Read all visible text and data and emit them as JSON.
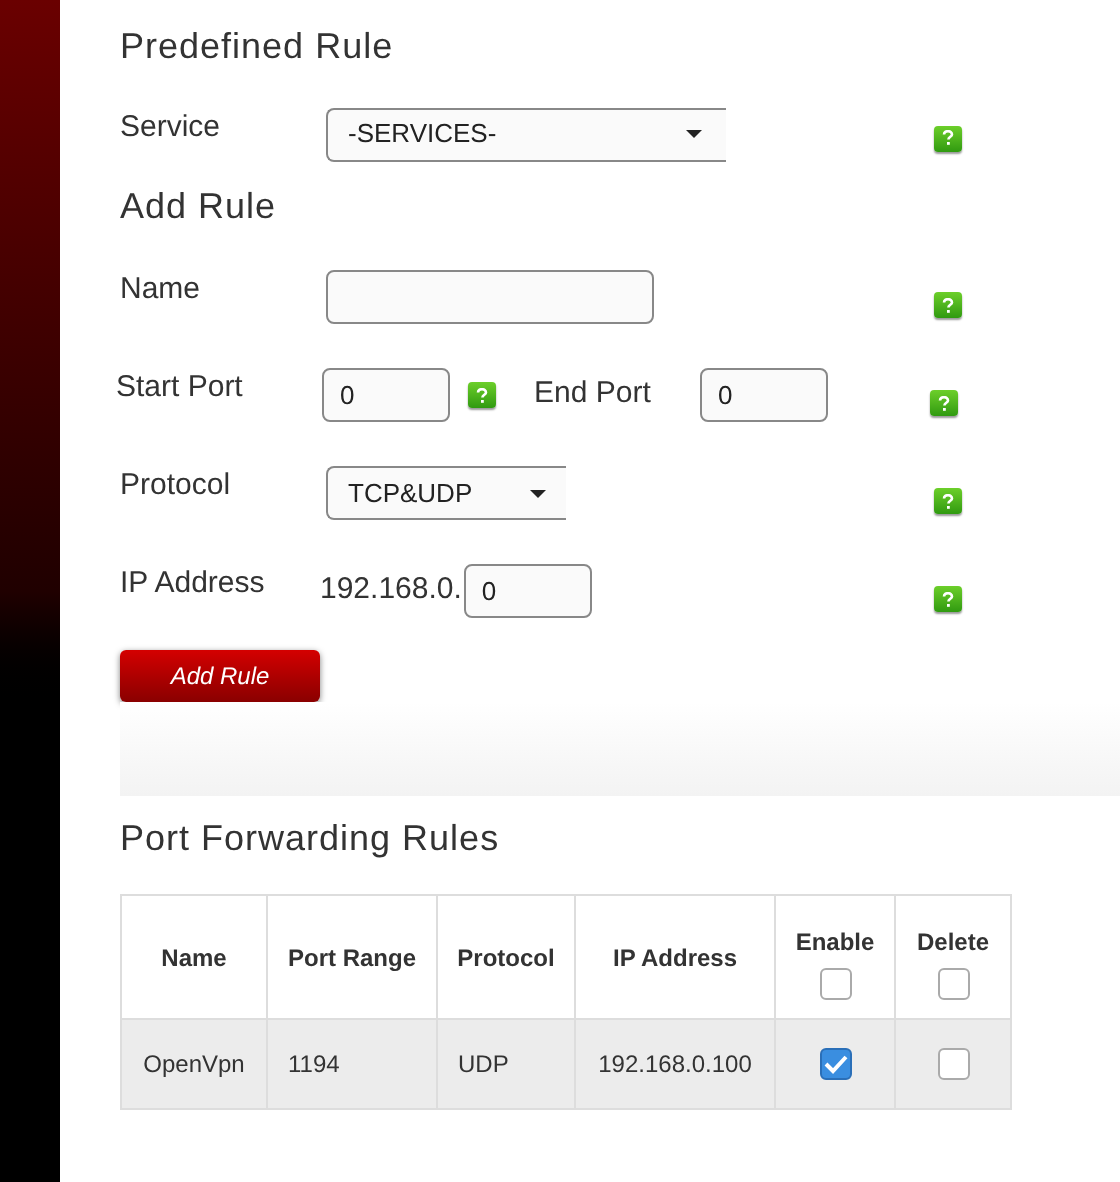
{
  "predefined": {
    "title": "Predefined Rule",
    "service": {
      "label": "Service",
      "value": "-SERVICES-"
    }
  },
  "add_rule": {
    "title": "Add Rule",
    "rows": [
      {
        "kind": "text",
        "label": "Name",
        "value": ""
      },
      {
        "kind": "ports",
        "label": "Start Port",
        "value": "0",
        "end_label": "End Port",
        "end_value": "0"
      },
      {
        "kind": "select",
        "label": "Protocol",
        "value": "TCP&UDP"
      },
      {
        "kind": "ip",
        "label": "IP Address",
        "prefix": "192.168.0.",
        "value": "0"
      }
    ],
    "button": "Add Rule"
  },
  "rules": {
    "title": "Port Forwarding Rules",
    "columns": [
      "Name",
      "Port Range",
      "Protocol",
      "IP Address",
      "Enable",
      "Delete"
    ],
    "header_checks": [
      {
        "checked": false
      },
      {
        "checked": false
      }
    ],
    "rows": [
      {
        "cells": [
          "OpenVpn",
          "1194",
          "UDP",
          "192.168.0.100"
        ],
        "enable": true,
        "delete": false
      }
    ]
  }
}
